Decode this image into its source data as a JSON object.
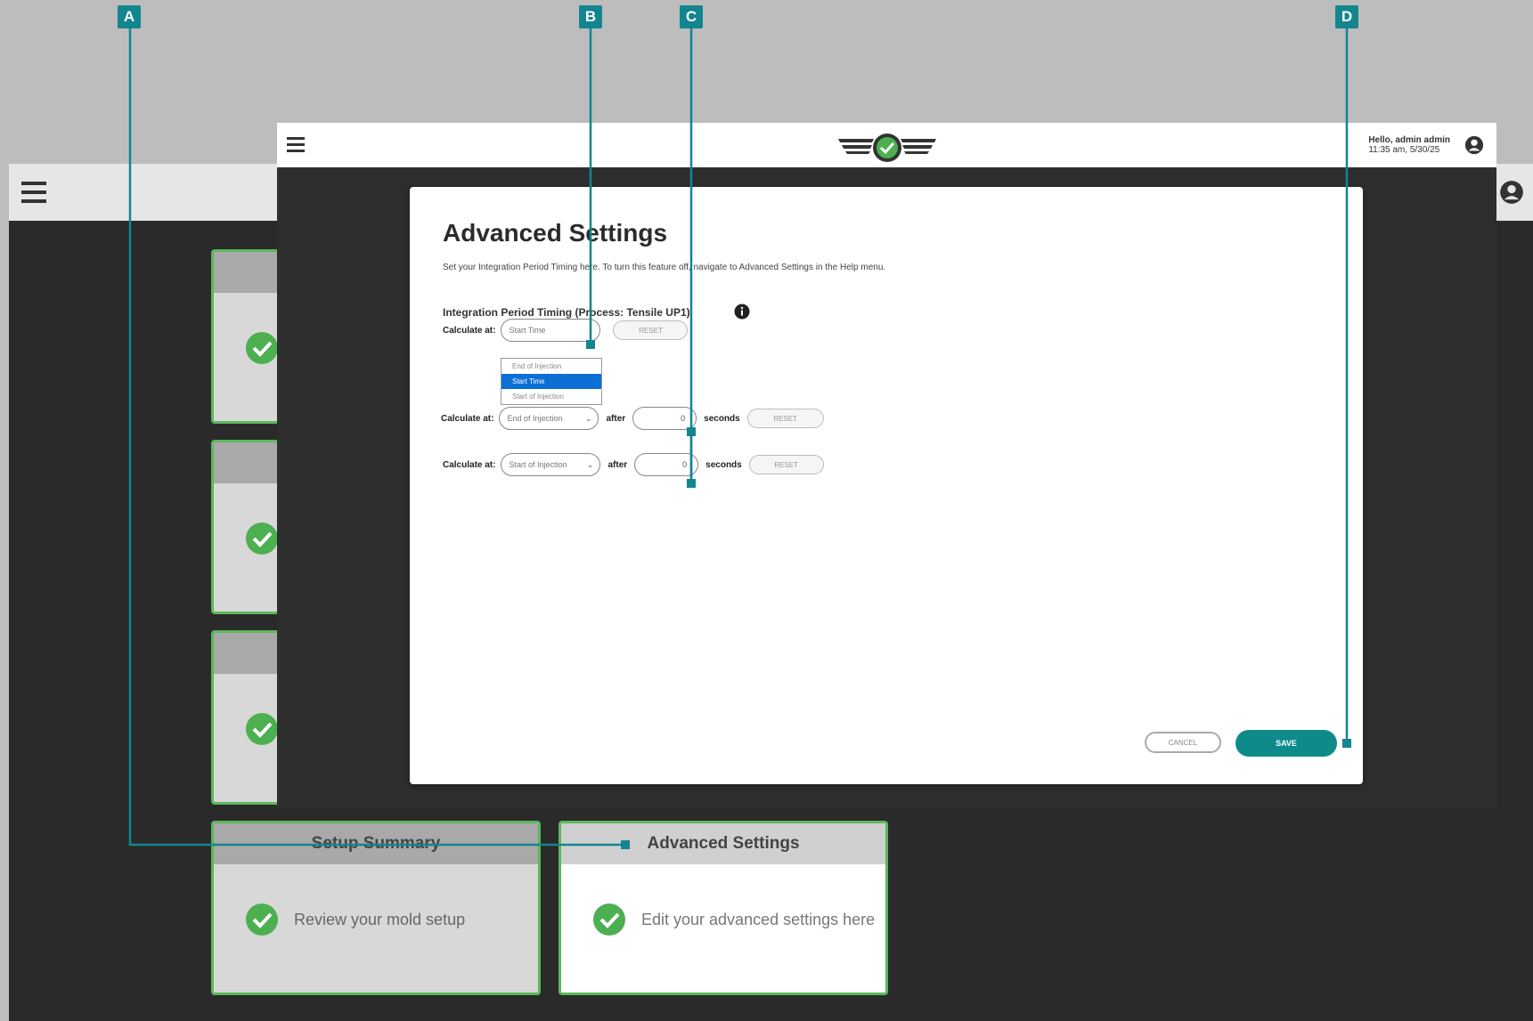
{
  "background_app": {
    "cards": [
      {
        "title": "",
        "text": ""
      },
      {
        "title": "",
        "text": ""
      },
      {
        "title": "",
        "text": ""
      },
      {
        "title": "Setup Summary",
        "text": "Review your mold setup"
      },
      {
        "title": "Advanced Settings",
        "text": "Edit your advanced settings here"
      }
    ]
  },
  "header": {
    "greeting": "Hello, admin admin",
    "datetime": "11:35 am, 5/30/25"
  },
  "dialog": {
    "title": "Advanced Settings",
    "subtitle": "Set your Integration Period Timing here. To turn this feature off, navigate to Advanced Settings in the Help menu.",
    "section_title": "Integration Period Timing (Process: Tensile UP1)",
    "row1": {
      "label": "Calculate at:",
      "select_value": "Start Time",
      "reset_label": "RESET"
    },
    "dropdown_options": [
      "End of Injection",
      "Start Time",
      "Start of Injection"
    ],
    "dropdown_selected": "Start Time",
    "row2": {
      "label": "Calculate at:",
      "select_value": "End of Injection",
      "after_label": "after",
      "input_value": "0",
      "seconds_label": "seconds",
      "reset_label": "RESET"
    },
    "row3": {
      "label": "Calculate at:",
      "select_value": "Start of Injection",
      "after_label": "after",
      "input_value": "0",
      "seconds_label": "seconds",
      "reset_label": "RESET"
    },
    "cancel_label": "CANCEL",
    "save_label": "SAVE"
  },
  "callouts": [
    "A",
    "B",
    "C",
    "D"
  ],
  "colors": {
    "accent_teal": "#13858e",
    "save_button": "#0e8a8a",
    "success_green": "#4caf50",
    "selected_option": "#0b6fd6"
  }
}
